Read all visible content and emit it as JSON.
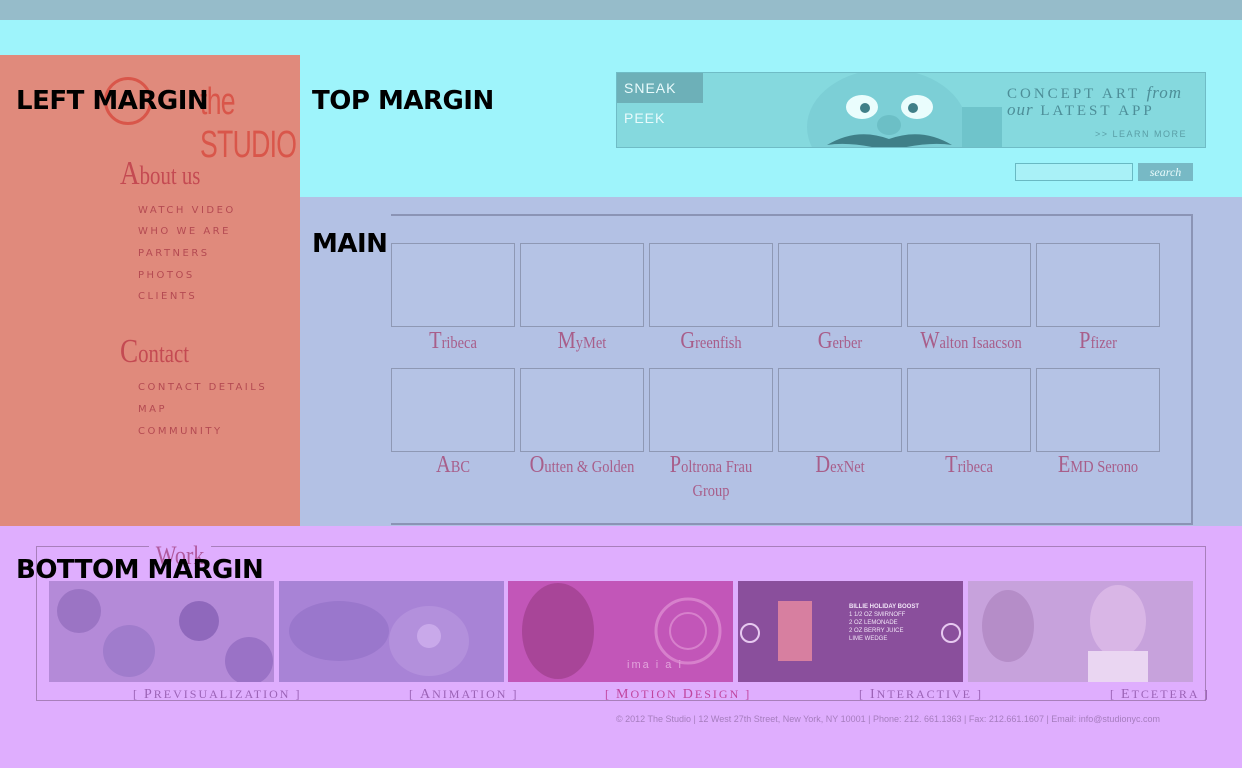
{
  "regions": {
    "left_margin": "LEFT MARGIN",
    "top_margin": "TOP MARGIN",
    "main": "MAIN",
    "bottom_margin": "BOTTOM MARGIN"
  },
  "logo": {
    "text": "the STUDIO"
  },
  "nav": {
    "about_heading_cap": "A",
    "about_heading_rest": "bout us",
    "about_items": [
      "WATCH VIDEO",
      "WHO WE ARE",
      "PARTNERS",
      "PHOTOS",
      "CLIENTS"
    ],
    "contact_heading_cap": "C",
    "contact_heading_rest": "ontact",
    "contact_items": [
      "CONTACT DETAILS",
      "MAP",
      "COMMUNITY"
    ]
  },
  "banner": {
    "tag": "SNEAK PEEK",
    "line1_a": "CONCEPT ART ",
    "line1_b": "from",
    "line2_a": "our",
    "line2_b": " LATEST APP",
    "learn_more": ">> LEARN MORE"
  },
  "search": {
    "placeholder": "",
    "button": "search"
  },
  "clients": [
    {
      "cap": "T",
      "rest": "ribeca"
    },
    {
      "cap": "M",
      "rest": "yMet"
    },
    {
      "cap": "G",
      "rest": "reenfish"
    },
    {
      "cap": "G",
      "rest": "erber"
    },
    {
      "cap": "W",
      "rest": "alton Isaacson"
    },
    {
      "cap": "P",
      "rest": "fizer"
    },
    {
      "cap": "A",
      "rest": "BC"
    },
    {
      "cap": "O",
      "rest": "utten & Golden"
    },
    {
      "cap": "P",
      "rest": "oltrona Frau Group"
    },
    {
      "cap": "D",
      "rest": "exNet"
    },
    {
      "cap": "T",
      "rest": "ribeca"
    },
    {
      "cap": "E",
      "rest": "MD Serono"
    }
  ],
  "work": {
    "title": "Work",
    "items": [
      {
        "cap": "P",
        "rest": "REVISUALIZATION",
        "color": "#b48ad8"
      },
      {
        "cap": "A",
        "rest": "NIMATION",
        "color": "#a883d6"
      },
      {
        "cap": "M",
        "rest": "OTION ",
        "cap2": "D",
        "rest2": "ESIGN",
        "color": "#c256b8"
      },
      {
        "cap": "I",
        "rest": "NTERACTIVE",
        "color": "#8a4f9c"
      },
      {
        "cap": "E",
        "rest": "TCETERA",
        "color": "#c7a2dc"
      }
    ],
    "interactive_overlay": [
      "BILLIE HOLIDAY BOOST",
      "1 1/2 OZ SMIRNOFF",
      "2 OZ LEMONADE",
      "2 OZ BERRY JUICE",
      "LIME WEDGE"
    ],
    "motion_overlay": "ima i a i"
  },
  "footer": "© 2012 The Studio | 12 West 27th Street, New York, NY 10001 | Phone: 212. 661.1363 | Fax: 212.661.1607 | Email: info@studionyc.com"
}
